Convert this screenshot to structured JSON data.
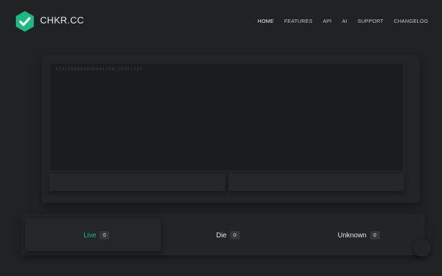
{
  "header": {
    "brand": "CHKR.CC",
    "nav": [
      "HOME",
      "FEATURES",
      "API",
      "AI",
      "SUPPORT",
      "CHANGELOG"
    ],
    "active_nav": "HOME"
  },
  "input": {
    "placeholder": "4532286063656641|08|2020|113"
  },
  "results": {
    "live": {
      "label": "Live",
      "count": "0"
    },
    "die": {
      "label": "Die",
      "count": "0"
    },
    "unknown": {
      "label": "Unknown",
      "count": "0"
    }
  },
  "colors": {
    "accent": "#1fb885",
    "background": "#202226"
  }
}
